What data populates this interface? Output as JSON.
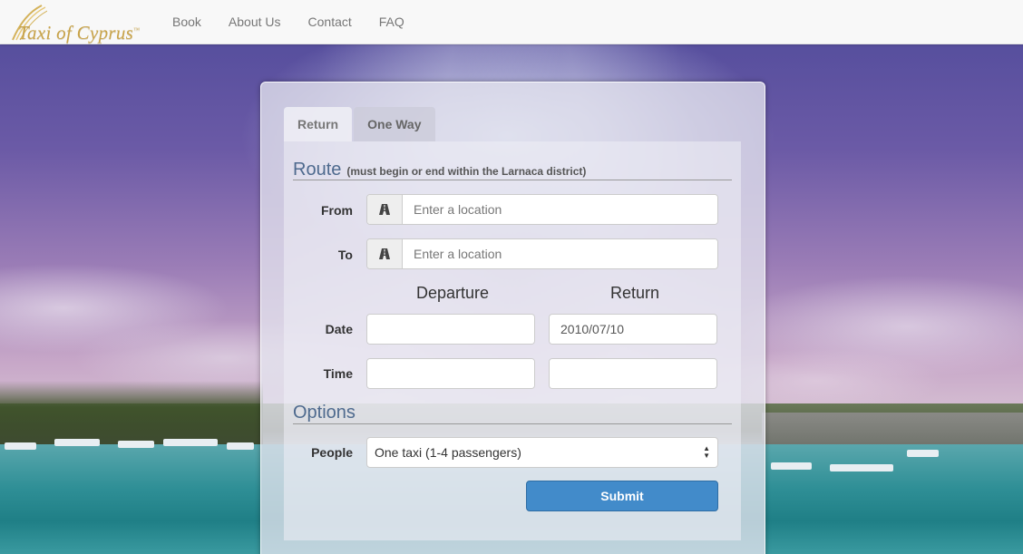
{
  "brand": {
    "name": "Taxi of Cyprus",
    "trademark": "™"
  },
  "nav": {
    "items": [
      {
        "label": "Book"
      },
      {
        "label": "About Us"
      },
      {
        "label": "Contact"
      },
      {
        "label": "FAQ"
      }
    ]
  },
  "tabs": [
    {
      "label": "Return",
      "active": true
    },
    {
      "label": "One Way",
      "active": false
    }
  ],
  "route": {
    "title": "Route",
    "note": "(must begin or end within the Larnaca district)",
    "from_label": "From",
    "from_placeholder": "Enter a location",
    "from_value": "",
    "to_label": "To",
    "to_placeholder": "Enter a location",
    "to_value": "",
    "location_icon": "road-icon"
  },
  "schedule": {
    "departure_heading": "Departure",
    "return_heading": "Return",
    "date_label": "Date",
    "time_label": "Time",
    "departure_date": "",
    "return_date": "2010/07/10",
    "departure_time": "",
    "return_time": "",
    "date_icon": "calendar-icon",
    "time_icon": "clock-icon"
  },
  "options": {
    "title": "Options",
    "people_label": "People",
    "people_selected": "One taxi (1-4 passengers)"
  },
  "submit_label": "Submit",
  "colors": {
    "accent": "#428bca",
    "legend": "#4e6a8e",
    "brand_gold": "#c9a44a"
  }
}
